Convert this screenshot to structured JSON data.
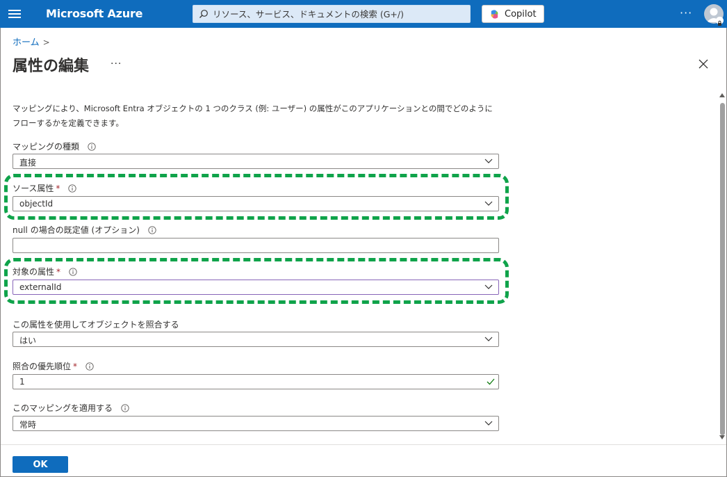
{
  "topbar": {
    "brand": "Microsoft Azure",
    "search_placeholder": "リソース、サービス、ドキュメントの検索 (G+/)",
    "copilot_label": "Copilot",
    "more_label": "···"
  },
  "breadcrumb": {
    "home": "ホーム",
    "separator": ">"
  },
  "page": {
    "title": "属性の編集",
    "more_label": "···",
    "description": "マッピングにより、Microsoft Entra オブジェクトの 1 つのクラス (例: ユーザー) の属性がこのアプリケーションとの間でどのようにフローするかを定義できます。"
  },
  "fields": {
    "mapping_type": {
      "label": "マッピングの種類",
      "value": "直接"
    },
    "source_attribute": {
      "label": "ソース属性",
      "required_mark": "*",
      "value": "objectId"
    },
    "default_if_null": {
      "label": "null の場合の既定値 (オプション)",
      "value": ""
    },
    "target_attribute": {
      "label": "対象の属性",
      "required_mark": "*",
      "value": "externalId"
    },
    "match_objects": {
      "label": "この属性を使用してオブジェクトを照合する",
      "value": "はい"
    },
    "match_precedence": {
      "label": "照合の優先順位",
      "required_mark": "*",
      "value": "1"
    },
    "apply_mapping": {
      "label": "このマッピングを適用する",
      "value": "常時"
    }
  },
  "footer": {
    "ok_label": "OK"
  },
  "colors": {
    "accent": "#0f6cbd",
    "highlight": "#0fa34a",
    "required": "#a4262c",
    "valid": "#107c10"
  }
}
